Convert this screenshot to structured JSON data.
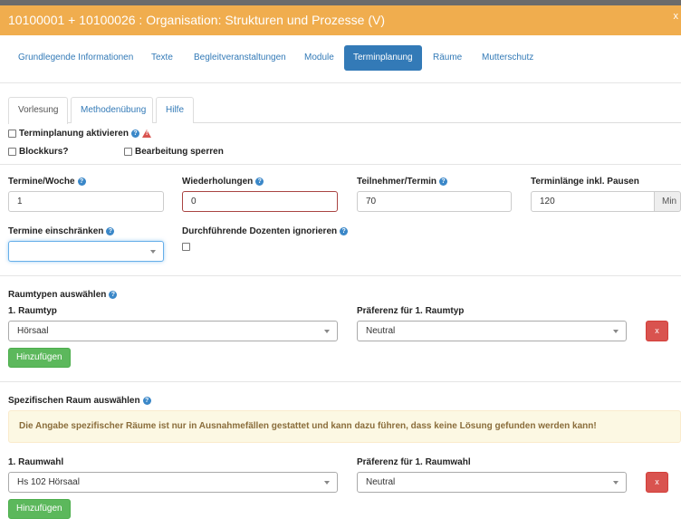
{
  "window": {
    "title": "10100001 + 10100026 : Organisation: Strukturen und Prozesse (V)",
    "close": "x"
  },
  "nav_pills": [
    {
      "label": "Grundlegende Informationen",
      "active": false
    },
    {
      "label": "Texte",
      "active": false
    },
    {
      "label": "Begleitveranstaltungen",
      "active": false
    },
    {
      "label": "Module",
      "active": false
    },
    {
      "label": "Terminplanung",
      "active": true
    },
    {
      "label": "Räume",
      "active": false
    },
    {
      "label": "Mutterschutz",
      "active": false
    }
  ],
  "tabs": [
    {
      "label": "Vorlesung",
      "active": true
    },
    {
      "label": "Methodenübung",
      "active": false
    },
    {
      "label": "Hilfe",
      "active": false
    }
  ],
  "checkboxes": {
    "terminplanung_aktivieren": "Terminplanung aktivieren",
    "blockkurs": "Blockkurs?",
    "bearbeitung_sperren": "Bearbeitung sperren"
  },
  "fields": {
    "termine_woche": {
      "label": "Termine/Woche",
      "value": "1"
    },
    "wiederholungen": {
      "label": "Wiederholungen",
      "value": "0"
    },
    "teilnehmer": {
      "label": "Teilnehmer/Termin",
      "value": "70"
    },
    "terminlaenge": {
      "label": "Terminlänge inkl. Pausen",
      "value": "120",
      "unit": "Min"
    },
    "termine_einschraenken": {
      "label": "Termine einschränken",
      "value": ""
    },
    "dozenten_ignorieren": {
      "label": "Durchführende Dozenten ignorieren"
    }
  },
  "raumtypen": {
    "heading": "Raumtypen auswählen",
    "type_label": "1. Raumtyp",
    "type_value": "Hörsaal",
    "pref_label": "Präferenz für 1. Raumtyp",
    "pref_value": "Neutral",
    "remove": "x",
    "add": "Hinzufügen"
  },
  "spezifisch": {
    "heading": "Spezifischen Raum auswählen",
    "alert": "Die Angabe spezifischer Räume ist nur in Ausnahmefällen gestattet und kann dazu führen, dass keine Lösung gefunden werden kann!",
    "room_label": "1. Raumwahl",
    "room_value": "Hs 102 Hörsaal",
    "pref_label": "Präferenz für 1. Raumwahl",
    "pref_value": "Neutral",
    "remove": "x",
    "add": "Hinzufügen"
  },
  "colors": {
    "title_bar": "#f0ad4e",
    "primary": "#337ab7",
    "success": "#5cb85c",
    "danger": "#d9534f",
    "alert_bg": "#fcf8e3"
  }
}
